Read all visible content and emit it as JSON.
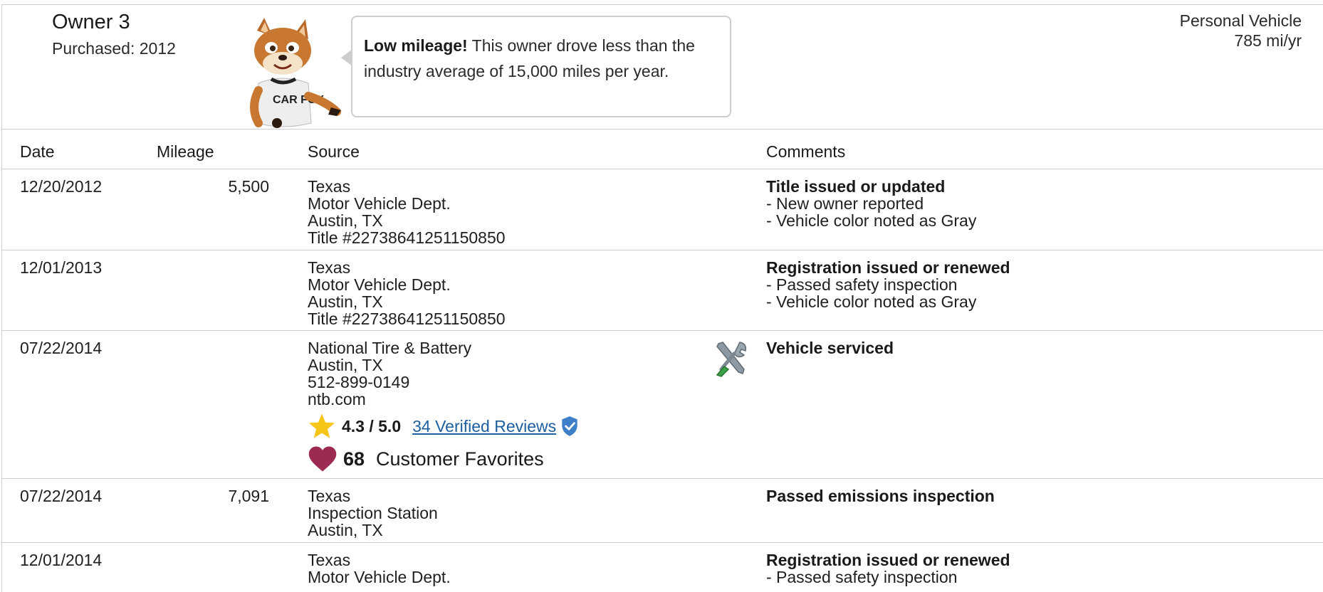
{
  "owner": {
    "title": "Owner 3",
    "purchased": "Purchased: 2012",
    "vehicle_type": "Personal Vehicle",
    "miles_per_year": "785 mi/yr"
  },
  "callout": {
    "bold": "Low mileage!",
    "line1_rest": " This owner drove less than the",
    "line2": "industry average of 15,000 miles per year."
  },
  "fox_shirt": "CAR FOX",
  "table": {
    "headers": {
      "date": "Date",
      "mileage": "Mileage",
      "source": "Source",
      "comments": "Comments"
    },
    "rows": [
      {
        "date": "12/20/2012",
        "mileage": "5,500",
        "source": [
          "Texas",
          "Motor Vehicle Dept.",
          "Austin, TX",
          "Title #22738641251150850"
        ],
        "comment_title": "Title issued or updated",
        "comments": [
          "- New owner reported",
          "- Vehicle color noted as Gray"
        ]
      },
      {
        "date": "12/01/2013",
        "mileage": "",
        "source": [
          "Texas",
          "Motor Vehicle Dept.",
          "Austin, TX",
          "Title #22738641251150850"
        ],
        "comment_title": "Registration issued or renewed",
        "comments": [
          "- Passed safety inspection",
          "- Vehicle color noted as Gray"
        ]
      },
      {
        "date": "07/22/2014",
        "mileage": "",
        "source": [
          "National Tire & Battery",
          "Austin, TX",
          "512-899-0149",
          "ntb.com"
        ],
        "rating": "4.3 / 5.0",
        "reviews": "34 Verified Reviews",
        "favorites_count": "68",
        "favorites_label": "Customer Favorites",
        "comment_title": "Vehicle serviced",
        "comments": []
      },
      {
        "date": "07/22/2014",
        "mileage": "7,091",
        "source": [
          "Texas",
          "Inspection Station",
          "Austin, TX"
        ],
        "comment_title": "Passed emissions inspection",
        "comments": []
      },
      {
        "date": "12/01/2014",
        "mileage": "",
        "source": [
          "Texas",
          "Motor Vehicle Dept."
        ],
        "comment_title": "Registration issued or renewed",
        "comments": [
          "- Passed safety inspection"
        ]
      }
    ]
  },
  "colors": {
    "link": "#1d5fa0",
    "star": "#f5c518",
    "heart": "#9c2a52",
    "shield": "#3d7fc9",
    "border": "#cfcfcf"
  },
  "icons": [
    "star-icon",
    "verified-shield-icon",
    "heart-icon",
    "tools-icon"
  ]
}
